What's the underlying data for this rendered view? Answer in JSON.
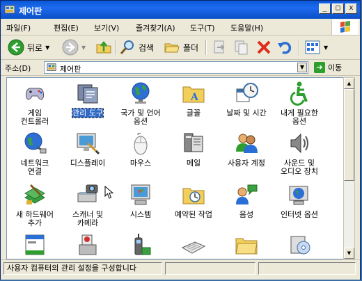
{
  "window": {
    "title": "제어판",
    "minimize": "_",
    "maximize": "□",
    "close": "x"
  },
  "menu": [
    "파일(F)",
    "편집(E)",
    "보기(V)",
    "즐겨찾기(A)",
    "도구(T)",
    "도움말(H)"
  ],
  "toolbar": {
    "back_label": "뒤로",
    "search_label": "검색",
    "folders_label": "폴더"
  },
  "address": {
    "label": "주소(D)",
    "value": "제어판",
    "go_label": "이동"
  },
  "items": [
    {
      "label": "게임\n컨트롤러",
      "icon": "game-controller-icon"
    },
    {
      "label": "관리 도구",
      "icon": "admin-tools-icon",
      "selected": true
    },
    {
      "label": "국가 및 언어\n옵션",
      "icon": "globe-icon"
    },
    {
      "label": "글꼴",
      "icon": "fonts-folder-icon"
    },
    {
      "label": "날짜 및 시간",
      "icon": "clock-icon"
    },
    {
      "label": "내게 필요한\n옵션",
      "icon": "accessibility-icon"
    },
    {
      "label": "네트워크\n연결",
      "icon": "network-icon"
    },
    {
      "label": "디스플레이",
      "icon": "display-icon"
    },
    {
      "label": "마우스",
      "icon": "mouse-icon"
    },
    {
      "label": "메일",
      "icon": "mail-icon"
    },
    {
      "label": "사용자 계정",
      "icon": "users-icon"
    },
    {
      "label": "사운드 및\n오디오 장치",
      "icon": "speaker-icon"
    },
    {
      "label": "새 하드웨어\n추가",
      "icon": "hardware-icon"
    },
    {
      "label": "스캐너 및\n카메라",
      "icon": "scanner-icon"
    },
    {
      "label": "시스템",
      "icon": "system-icon"
    },
    {
      "label": "예약된 작업",
      "icon": "scheduled-tasks-icon"
    },
    {
      "label": "음성",
      "icon": "speech-icon"
    },
    {
      "label": "인터넷 옵션",
      "icon": "internet-icon"
    },
    {
      "label": "",
      "icon": "taskbar-icon"
    },
    {
      "label": "",
      "icon": "add-remove-icon"
    },
    {
      "label": "",
      "icon": "phone-modem-icon"
    },
    {
      "label": "",
      "icon": "keyboard-icon"
    },
    {
      "label": "",
      "icon": "folder-options-icon"
    },
    {
      "label": "",
      "icon": "program-install-icon"
    }
  ],
  "status": {
    "text": "사용자 컴퓨터의 관리 설정을 구성합니다"
  }
}
